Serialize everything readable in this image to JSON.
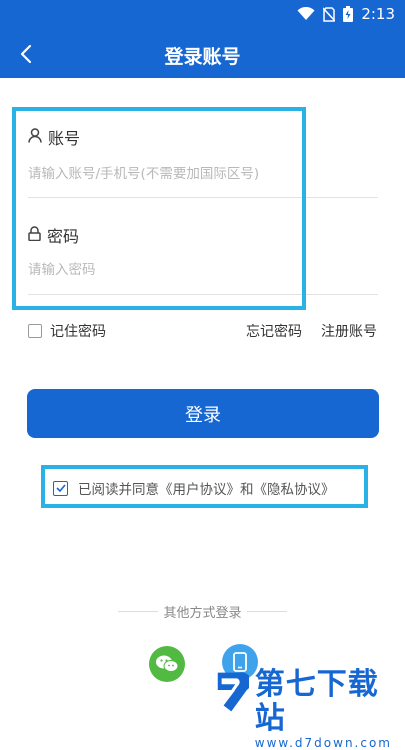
{
  "status": {
    "time": "2:13"
  },
  "appbar": {
    "title": "登录账号"
  },
  "form": {
    "account_label": "账号",
    "account_placeholder": "请输入账号/手机号(不需要加国际区号)",
    "password_label": "密码",
    "password_placeholder": "请输入密码",
    "remember_label": "记住密码",
    "forgot_label": "忘记密码",
    "register_label": "注册账号",
    "login_label": "登录",
    "agree_text": "已阅读并同意《用户协议》和《隐私协议》",
    "agree_checked": true
  },
  "other": {
    "title": "其他方式登录"
  },
  "watermark": {
    "title": "第七下载站",
    "url": "www.d7down.com"
  },
  "colors": {
    "primary": "#1767d3",
    "highlight": "#2ab2e6",
    "wechat": "#52b943",
    "phone": "#3fa3ec"
  }
}
